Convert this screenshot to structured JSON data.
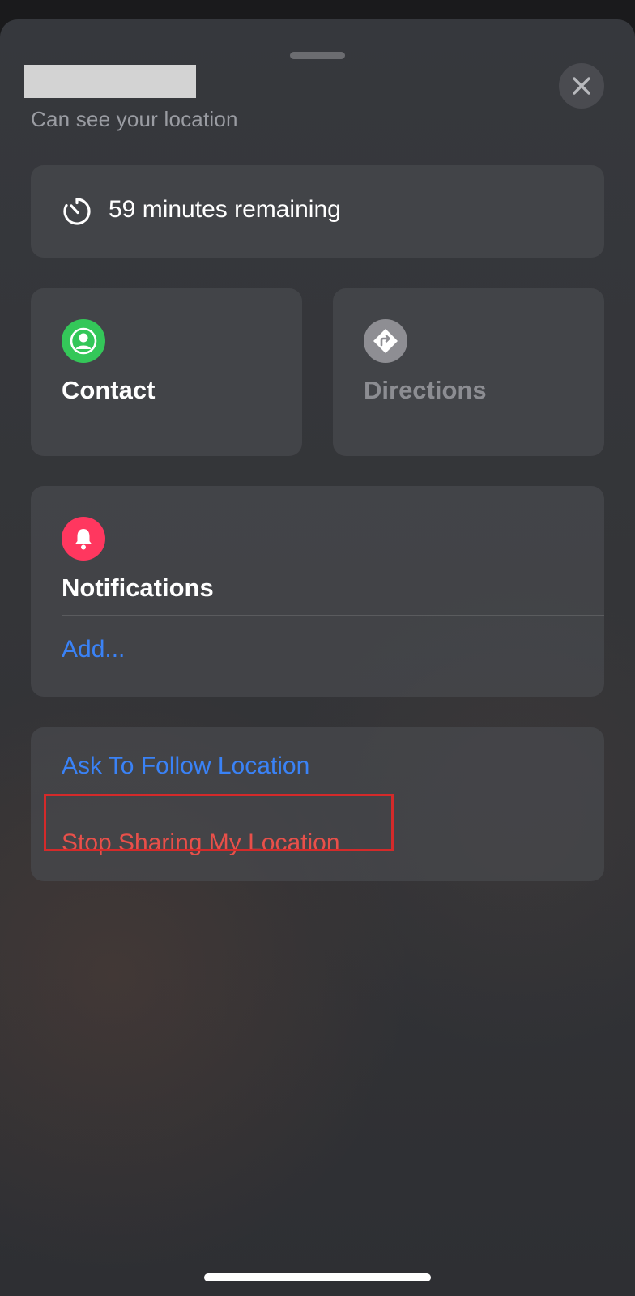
{
  "header": {
    "subtitle": "Can see your location"
  },
  "timer": {
    "text": "59 minutes remaining",
    "icon": "timer-icon"
  },
  "contact": {
    "label": "Contact",
    "icon": "person-icon",
    "icon_color": "#34c759"
  },
  "directions": {
    "label": "Directions",
    "icon": "directions-arrow-icon",
    "icon_color": "#8e8e93"
  },
  "notifications": {
    "label": "Notifications",
    "icon": "bell-icon",
    "icon_color": "#ff375f",
    "add_label": "Add..."
  },
  "actions": {
    "follow_label": "Ask To Follow Location",
    "stop_label": "Stop Sharing My Location",
    "link_color": "#3a82f6",
    "destructive_color": "#e8504a"
  }
}
